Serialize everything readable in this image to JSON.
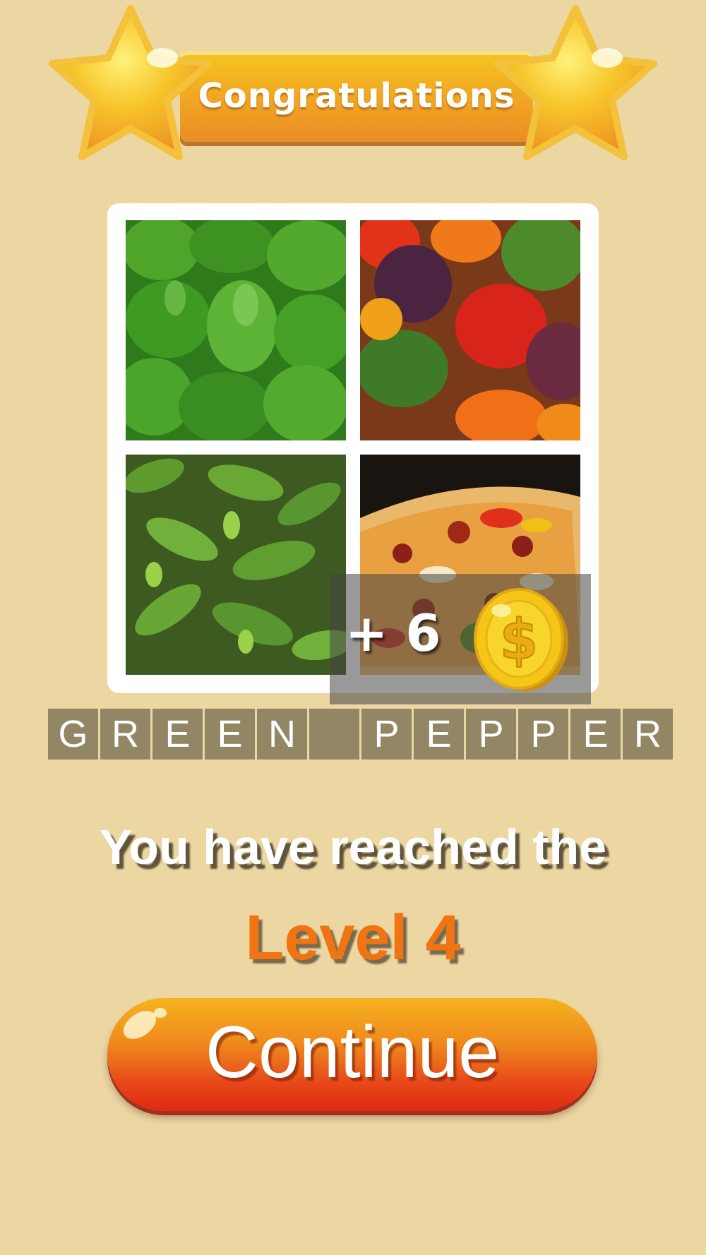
{
  "banner": {
    "title": "Congratulations"
  },
  "reward": {
    "text": "+ 6",
    "icon": "gold-coin-icon"
  },
  "answer": {
    "letters": [
      "G",
      "R",
      "E",
      "E",
      "N",
      "",
      "P",
      "E",
      "P",
      "P",
      "E",
      "R"
    ]
  },
  "message": {
    "line1": "You have reached the",
    "level": "Level 4"
  },
  "continue_button": {
    "label": "Continue"
  },
  "colors": {
    "background": "#ecd6a2",
    "letter_slot": "#938664",
    "level_text": "#f07412",
    "button_top": "#f5b31e",
    "button_bottom": "#de2a12"
  }
}
